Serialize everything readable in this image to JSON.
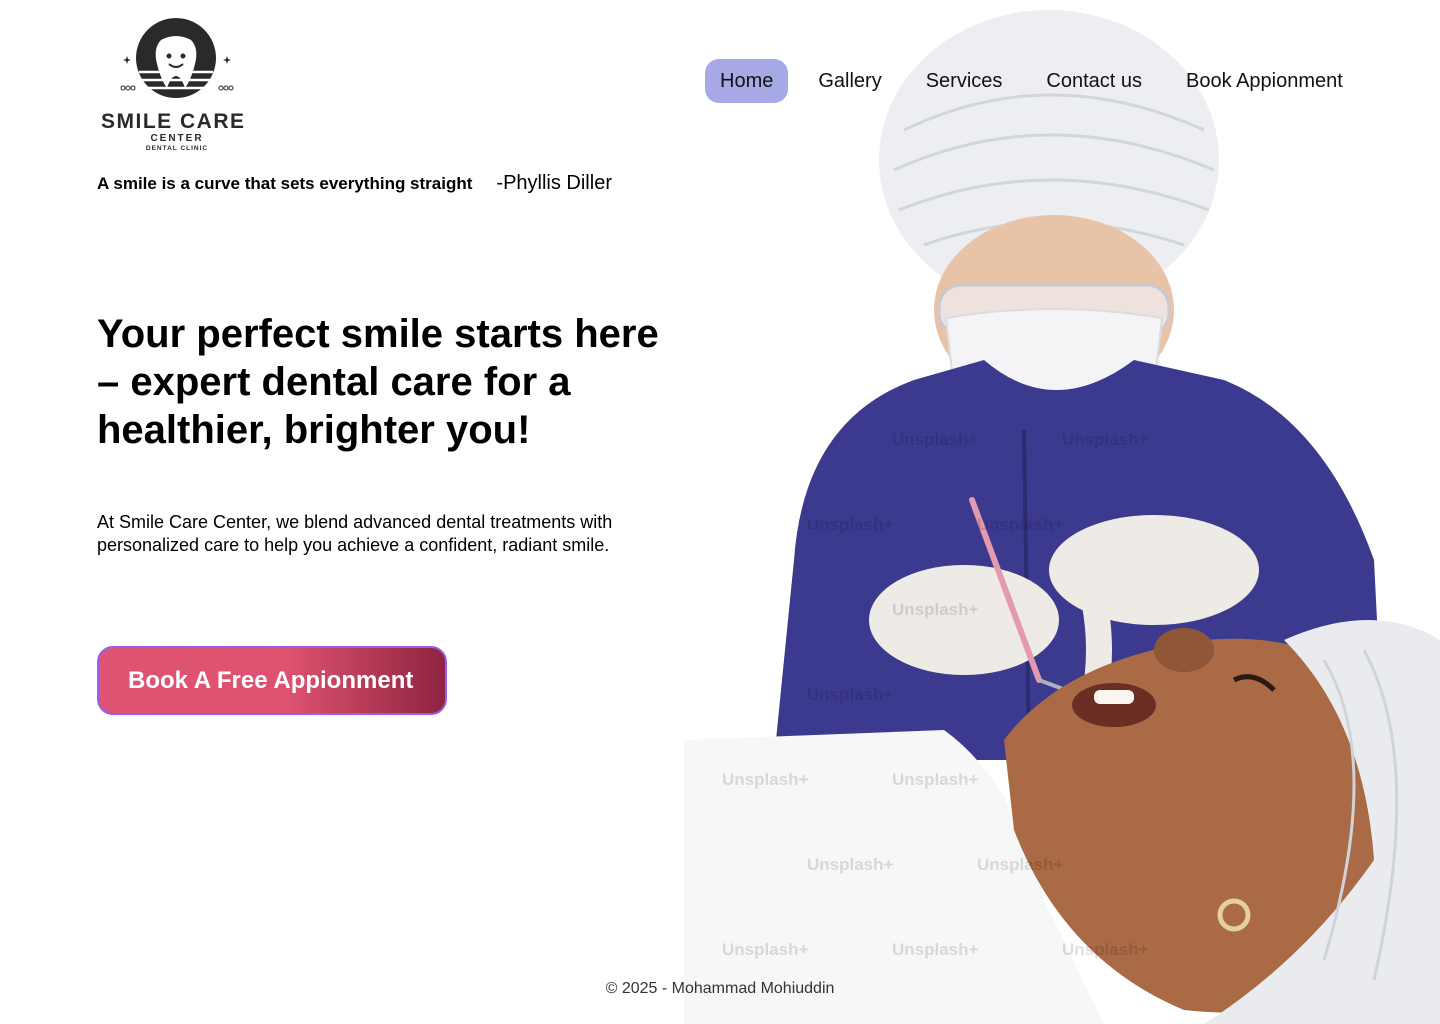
{
  "brand": {
    "name": "SMILE CARE",
    "sub": "CENTER",
    "tagline": "DENTAL CLINIC"
  },
  "nav": {
    "items": [
      {
        "label": "Home",
        "active": true
      },
      {
        "label": "Gallery",
        "active": false
      },
      {
        "label": "Services",
        "active": false
      },
      {
        "label": "Contact us",
        "active": false
      },
      {
        "label": "Book Appionment",
        "active": false
      }
    ],
    "active_color": "#a7a9e6"
  },
  "quote": {
    "text": "A smile is a curve that sets everything straight",
    "author": "-Phyllis Diller"
  },
  "hero": {
    "headline": "Your perfect smile starts here – expert dental care for a healthier, brighter you!",
    "description": "At Smile Care Center, we blend advanced dental treatments with personalized care to help you achieve a confident, radiant smile.",
    "cta_label": "Book A Free Appionment",
    "cta_color": "#de5472",
    "image_watermark": "Unsplash+"
  },
  "footer": {
    "text": "© 2025 - Mohammad Mohiuddin"
  }
}
